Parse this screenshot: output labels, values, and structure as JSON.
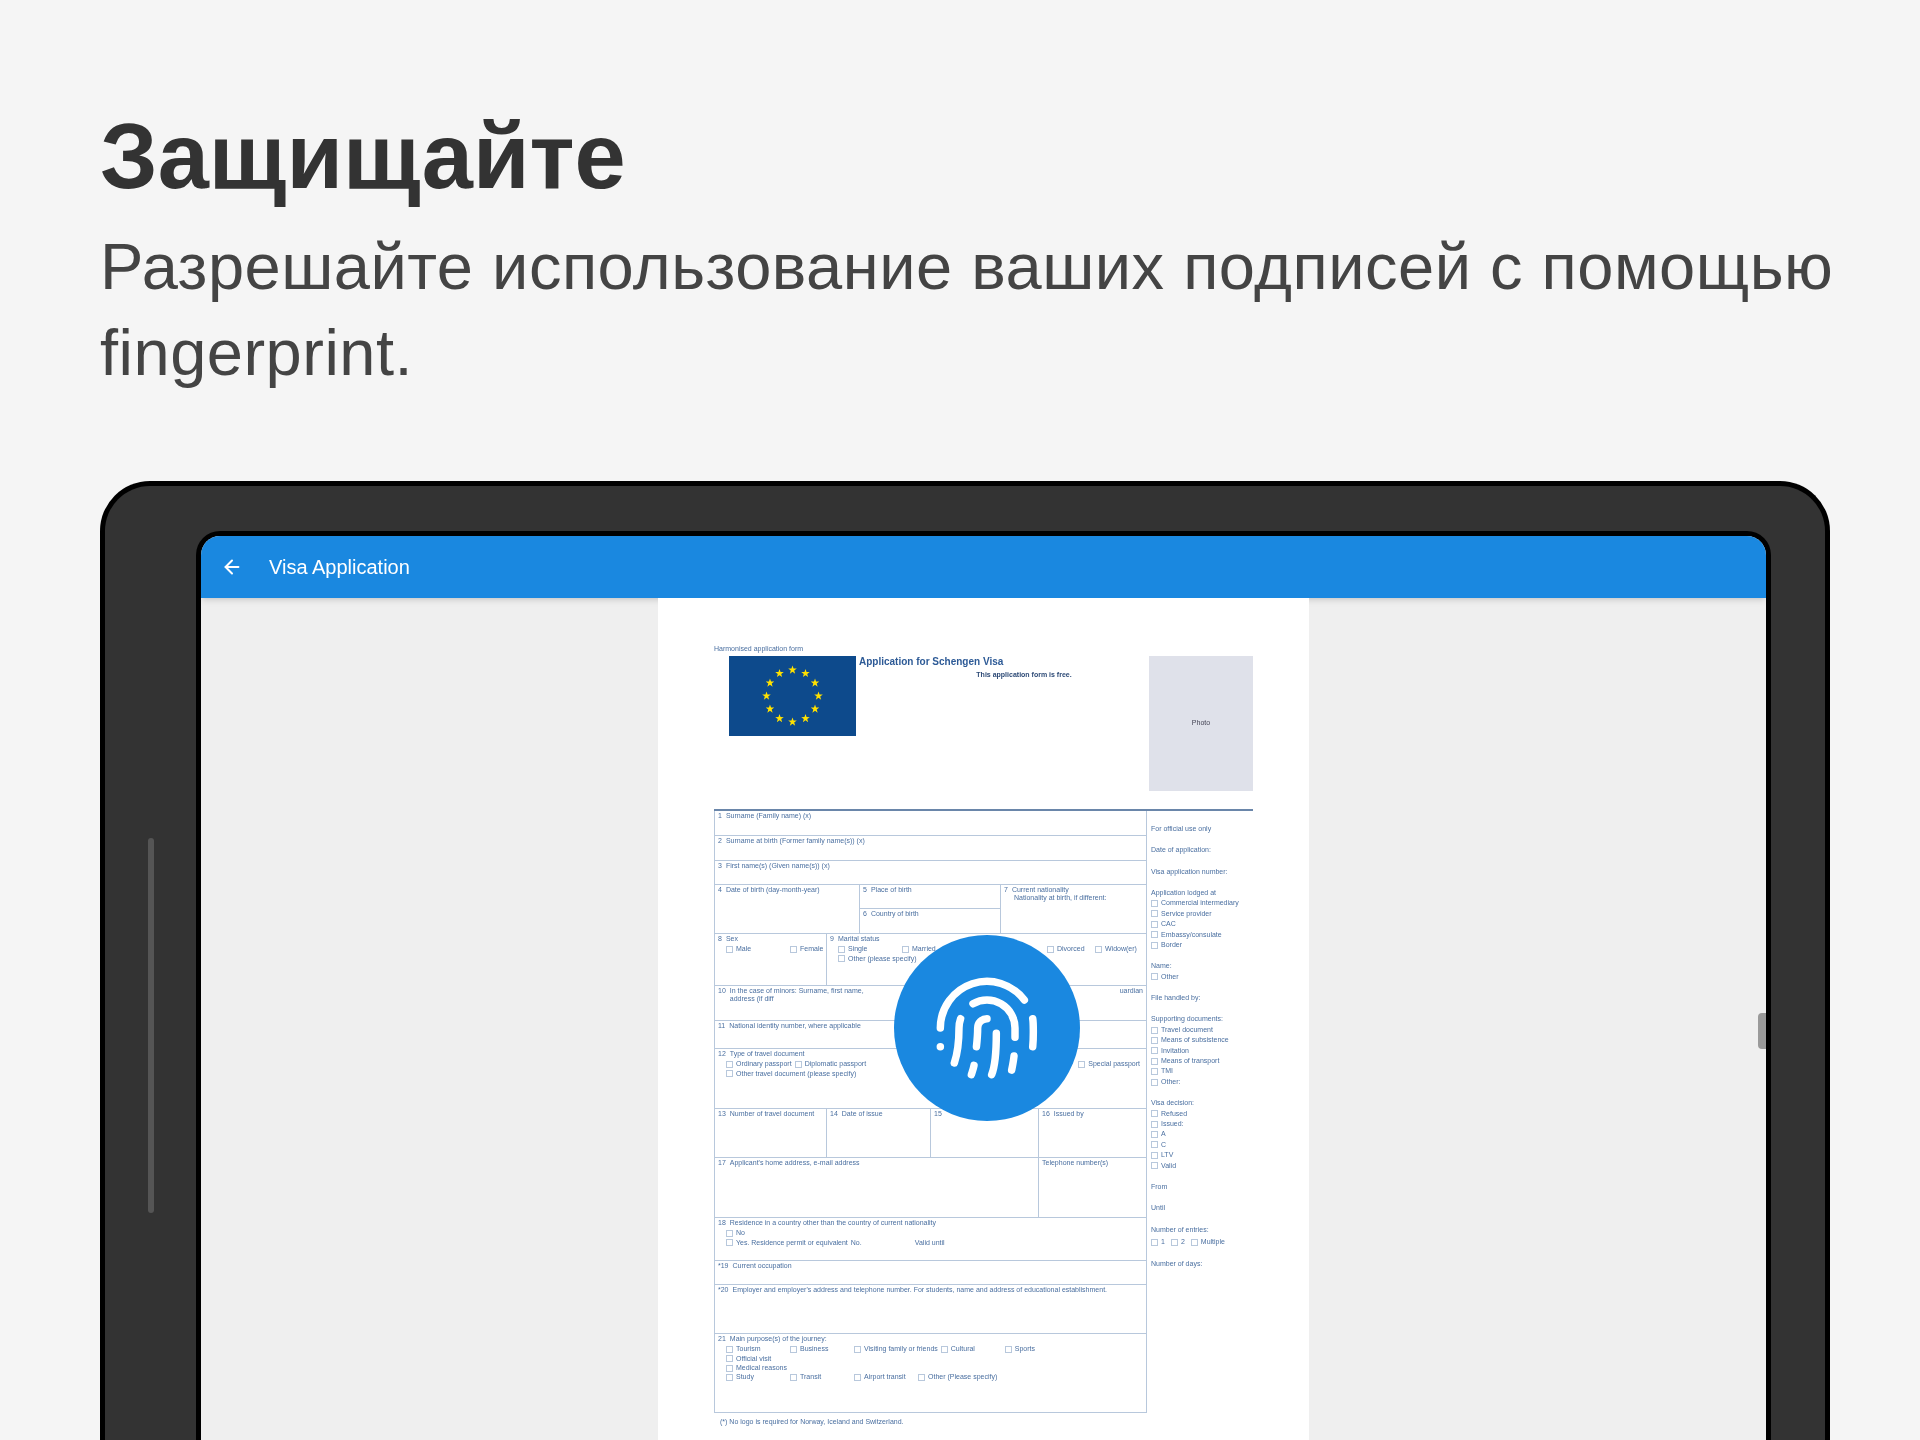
{
  "headline": "Защищайте",
  "subtitle": "Разрешайте использование ваших подписей с помощью fingerprint.",
  "app_bar": {
    "title": "Visa Application"
  },
  "document": {
    "form_name": "Harmonised application form",
    "title": "Application for Schengen Visa",
    "subtitle": "This application form is free.",
    "photo_label": "Photo",
    "sections": [
      {
        "fields": [
          {
            "number": "1",
            "label": "Surname (Family name) (x)"
          }
        ]
      },
      {
        "fields": [
          {
            "number": "2",
            "label": "Surname at birth (Former family name(s)) (x)"
          }
        ]
      },
      {
        "fields": [
          {
            "number": "3",
            "label": "First name(s) (Given name(s)) (x)"
          }
        ]
      },
      {
        "fields": [
          {
            "number": "4",
            "label": "Date of birth (day-month-year)"
          },
          {
            "stack": [
              {
                "number": "5",
                "label": "Place of birth"
              },
              {
                "number": "6",
                "label": "Country of birth"
              }
            ]
          },
          {
            "number": "7",
            "label": "Current nationality",
            "note": "Nationality at birth, if different:"
          }
        ]
      },
      {
        "fields": [
          {
            "number": "8",
            "label": "Sex",
            "option_lines": [
              {
                "left": [
                  {
                    "kind": "checkbox",
                    "label": "Male",
                    "checked": false
                  },
                  {
                    "kind": "checkbox",
                    "label": "Female",
                    "checked": false
                  }
                ]
              }
            ]
          },
          {
            "number": "9",
            "label": "Marital status",
            "option_lines": [
              {
                "left": [
                  {
                    "kind": "checkbox",
                    "label": "Single",
                    "checked": false
                  },
                  {
                    "kind": "checkbox",
                    "label": "Married",
                    "checked": false
                  }
                ],
                "right": [
                  {
                    "kind": "checkbox",
                    "label": "Divorced",
                    "checked": false
                  },
                  {
                    "kind": "checkbox",
                    "label": "Widow(er)",
                    "checked": false
                  }
                ]
              },
              {
                "left": [
                  {
                    "kind": "checkbox",
                    "label": "Other (please specify)",
                    "checked": false
                  }
                ]
              }
            ]
          }
        ]
      },
      {
        "fields": [
          {
            "number": "10",
            "label": "In the case of minors: Surname, first name, address (if diff",
            "tail": "uardian"
          }
        ]
      },
      {
        "fields": [
          {
            "number": "11",
            "label": "National identity number, where applicable"
          }
        ]
      },
      {
        "fields": [
          {
            "number": "12",
            "label": "Type of travel document",
            "option_lines": [
              {
                "left": [
                  {
                    "kind": "checkbox",
                    "label": "Ordinary passport",
                    "checked": false
                  },
                  {
                    "kind": "checkbox",
                    "label": "Diplomatic passport",
                    "checked": false
                  }
                ],
                "right": [
                  {
                    "kind": "checkbox",
                    "label": "Special passport",
                    "checked": false
                  }
                ]
              },
              {
                "left": [
                  {
                    "kind": "checkbox",
                    "label": "Other travel document (please specify)",
                    "checked": false
                  }
                ]
              }
            ]
          }
        ]
      },
      {
        "fields": [
          {
            "number": "13",
            "label": "Number of travel document"
          },
          {
            "number": "14",
            "label": "Date of issue"
          },
          {
            "number": "15"
          },
          {
            "number": "16",
            "label": "Issued by"
          }
        ]
      },
      {
        "fields": [
          {
            "number": "17",
            "label": "Applicant's home address, e-mail address"
          },
          {
            "label": "Telephone number(s)"
          }
        ]
      },
      {
        "fields": [
          {
            "number": "18",
            "label": "Residence in a country other than the country of current nationality",
            "option_lines": [
              {
                "left": [
                  {
                    "kind": "checkbox",
                    "label": "No",
                    "checked": false
                  }
                ]
              },
              {
                "left": [
                  {
                    "kind": "checkbox",
                    "label": "Yes. Residence permit or equivalent",
                    "checked": false
                  },
                  {
                    "kind": "text",
                    "label": "No."
                  },
                  {
                    "kind": "text",
                    "label": "Valid until"
                  }
                ]
              }
            ]
          }
        ]
      },
      {
        "fields": [
          {
            "number": "*19",
            "label": "Current occupation"
          }
        ]
      },
      {
        "fields": [
          {
            "number": "*20",
            "label": "Employer and employer's address and telephone number. For students, name and address of educational establishment."
          }
        ]
      },
      {
        "fields": [
          {
            "number": "21",
            "label": "Main purpose(s) of the journey:",
            "option_lines": [
              {
                "left": [
                  {
                    "kind": "checkbox",
                    "label": "Tourism",
                    "checked": false
                  },
                  {
                    "kind": "checkbox",
                    "label": "Business",
                    "checked": false
                  },
                  {
                    "kind": "checkbox",
                    "label": "Visiting family or friends",
                    "checked": false
                  },
                  {
                    "kind": "checkbox",
                    "label": "Cultural",
                    "checked": false
                  },
                  {
                    "kind": "checkbox",
                    "label": "Sports",
                    "checked": false
                  }
                ]
              },
              {
                "left": [
                  {
                    "kind": "checkbox",
                    "label": "Official visit",
                    "checked": false
                  }
                ]
              },
              {
                "left": [
                  {
                    "kind": "checkbox",
                    "label": "Medical reasons",
                    "checked": false
                  }
                ]
              },
              {
                "left": [
                  {
                    "kind": "checkbox",
                    "label": "Study",
                    "checked": false
                  },
                  {
                    "kind": "checkbox",
                    "label": "Transit",
                    "checked": false
                  },
                  {
                    "kind": "checkbox",
                    "label": "Airport transit",
                    "checked": false
                  },
                  {
                    "kind": "checkbox",
                    "label": "Other (Please specify)",
                    "checked": false
                  }
                ]
              }
            ]
          }
        ]
      }
    ],
    "official_use": [
      {
        "kind": "heading",
        "label": "For official use only"
      },
      {
        "kind": "heading",
        "label": "Date of application:"
      },
      {
        "kind": "heading",
        "label": "Visa application number:"
      },
      {
        "kind": "heading",
        "label": "Application lodged at"
      },
      {
        "kind": "checkbox",
        "label": "Commercial intermediary",
        "checked": false
      },
      {
        "kind": "checkbox",
        "label": "Service provider",
        "checked": false
      },
      {
        "kind": "checkbox",
        "label": "CAC",
        "checked": false
      },
      {
        "kind": "checkbox",
        "label": "Embassy/consulate",
        "checked": false
      },
      {
        "kind": "checkbox",
        "label": "Border",
        "checked": false
      },
      {
        "kind": "heading",
        "label": "Name:"
      },
      {
        "kind": "checkbox",
        "label": "Other",
        "checked": false
      },
      {
        "kind": "heading",
        "label": "File handled by:"
      },
      {
        "kind": "heading",
        "label": "Supporting documents:"
      },
      {
        "kind": "checkbox",
        "label": "Travel document",
        "checked": false
      },
      {
        "kind": "checkbox",
        "label": "Means of subsistence",
        "checked": false
      },
      {
        "kind": "checkbox",
        "label": "Invitation",
        "checked": false
      },
      {
        "kind": "checkbox",
        "label": "Means of transport",
        "checked": false
      },
      {
        "kind": "checkbox",
        "label": "TMI",
        "checked": false
      },
      {
        "kind": "checkbox",
        "label": "Other:",
        "checked": false
      },
      {
        "kind": "heading",
        "label": "Visa decision:"
      },
      {
        "kind": "checkbox",
        "label": "Refused",
        "checked": false
      },
      {
        "kind": "checkbox",
        "label": "Issued:",
        "checked": false
      },
      {
        "kind": "checkbox",
        "label": "A",
        "checked": false
      },
      {
        "kind": "checkbox",
        "label": "C",
        "checked": false
      },
      {
        "kind": "checkbox",
        "label": "LTV",
        "checked": false
      },
      {
        "kind": "checkbox",
        "label": "Valid",
        "checked": false
      },
      {
        "kind": "heading",
        "label": "From"
      },
      {
        "kind": "heading",
        "label": "Until"
      },
      {
        "kind": "heading",
        "label": "Number of entries:"
      },
      {
        "kind": "checkbox_row",
        "options": [
          {
            "label": "1",
            "checked": false
          },
          {
            "label": "2",
            "checked": false
          },
          {
            "label": "Multiple",
            "checked": false
          }
        ]
      },
      {
        "kind": "heading",
        "label": "Number of days:"
      }
    ],
    "footnote": "(*) No logo is required for Norway, Iceland and Switzerland."
  }
}
